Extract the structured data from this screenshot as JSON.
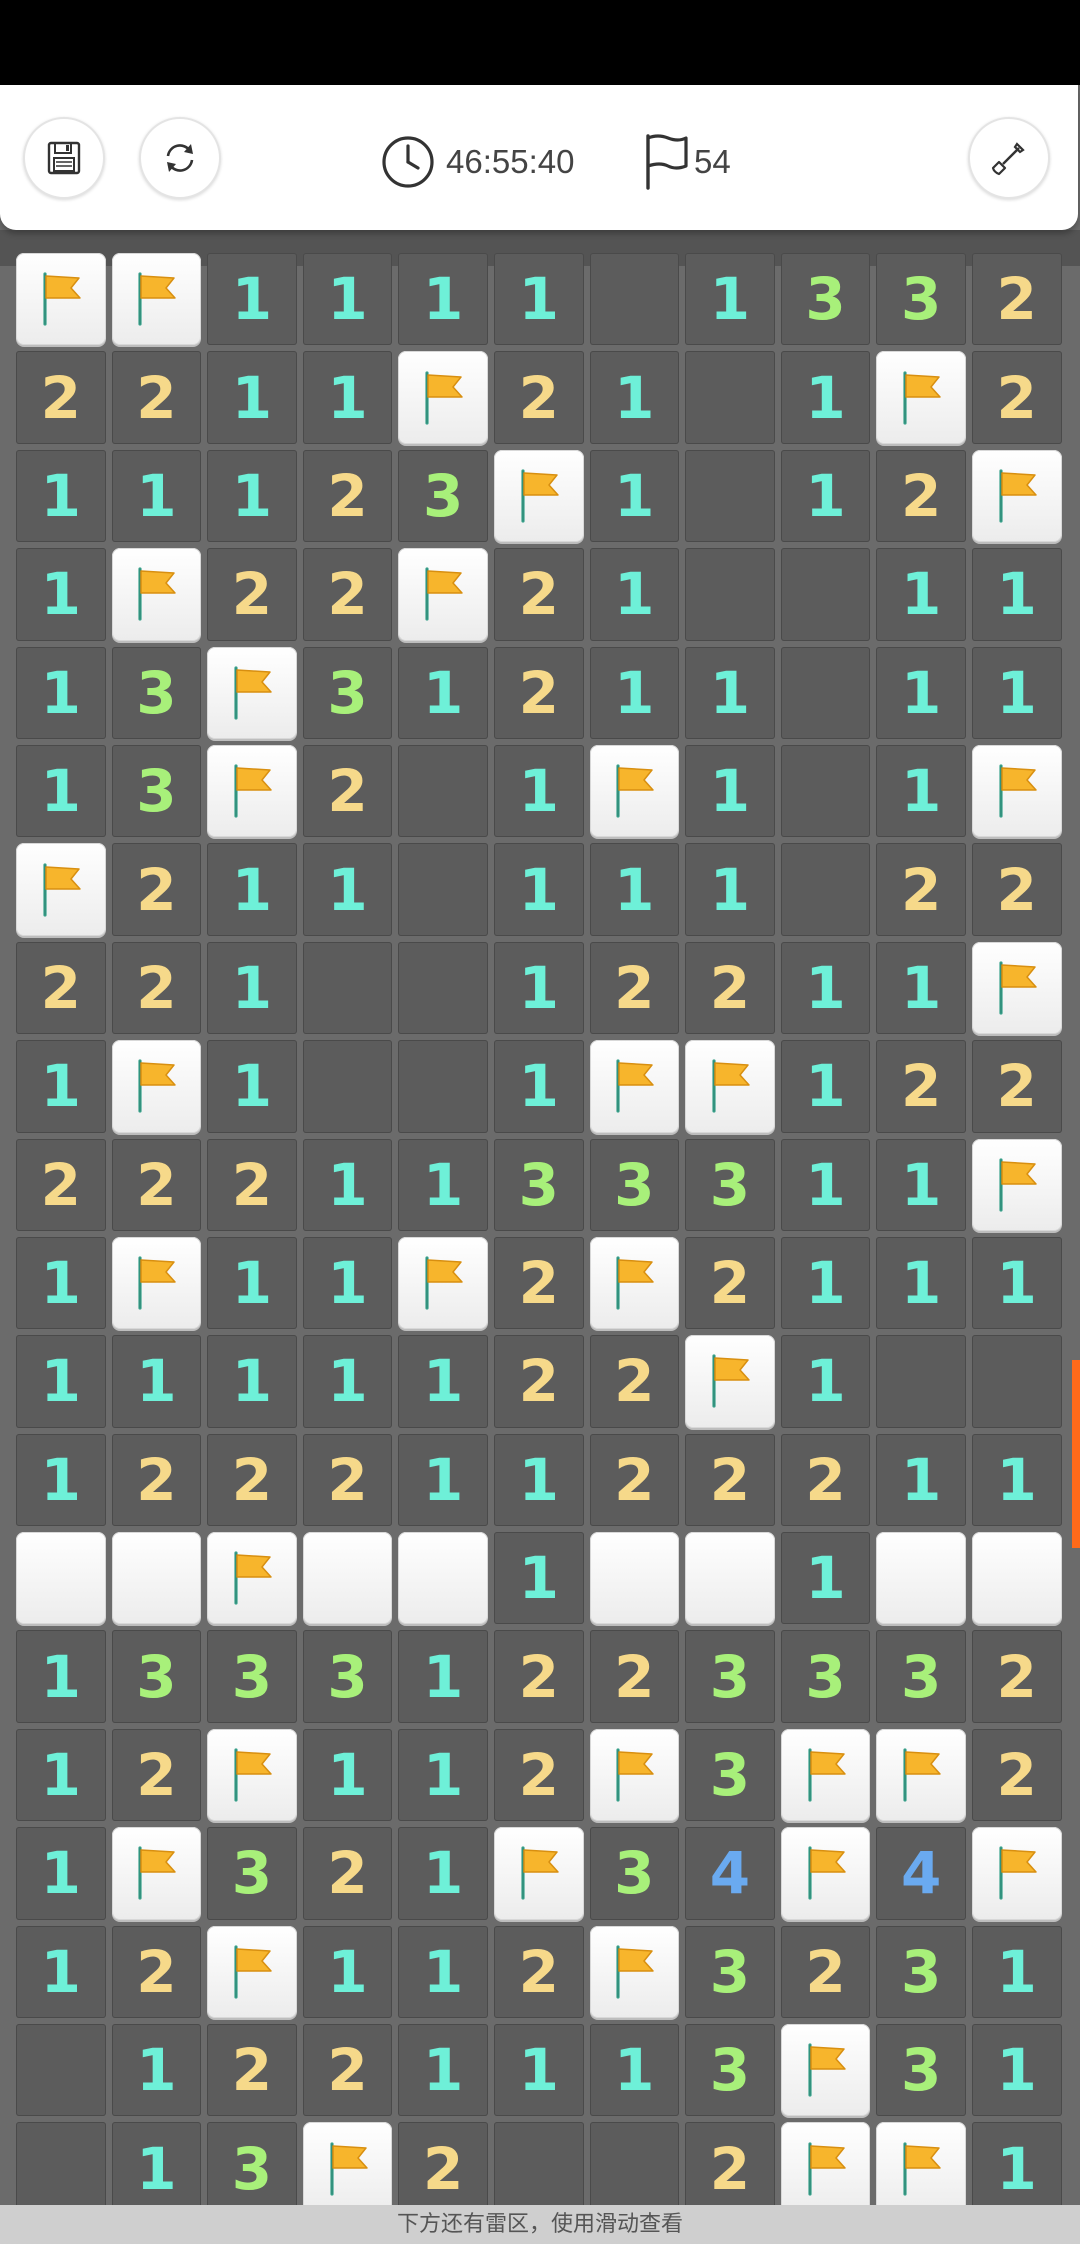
{
  "toolbar": {
    "timer": "46:55:40",
    "flags_remaining": "54"
  },
  "tip": "下方还有雷区，使用滑动查看",
  "colors": {
    "n1": "#6ef0d8",
    "n2": "#f6d98a",
    "n3": "#a8f07a",
    "n4": "#6aaaf0",
    "flag": "#f7b52c"
  },
  "grid": [
    [
      "F",
      "F",
      "1",
      "1",
      "1",
      "1",
      "0",
      "1",
      "3",
      "3",
      "2"
    ],
    [
      "2",
      "2",
      "1",
      "1",
      "F",
      "2",
      "1",
      "0",
      "1",
      "F",
      "2"
    ],
    [
      "1",
      "1",
      "1",
      "2",
      "3",
      "F",
      "1",
      "0",
      "1",
      "2",
      "F"
    ],
    [
      "1",
      "F",
      "2",
      "2",
      "F",
      "2",
      "1",
      "0",
      "0",
      "1",
      "1"
    ],
    [
      "1",
      "3",
      "F",
      "3",
      "1",
      "2",
      "1",
      "1",
      "0",
      "1",
      "1"
    ],
    [
      "1",
      "3",
      "F",
      "2",
      "0",
      "1",
      "F",
      "1",
      "0",
      "1",
      "F"
    ],
    [
      "F",
      "2",
      "1",
      "1",
      "0",
      "1",
      "1",
      "1",
      "0",
      "2",
      "2"
    ],
    [
      "2",
      "2",
      "1",
      "0",
      "0",
      "1",
      "2",
      "2",
      "1",
      "1",
      "F"
    ],
    [
      "1",
      "F",
      "1",
      "0",
      "0",
      "1",
      "F",
      "F",
      "1",
      "2",
      "2"
    ],
    [
      "2",
      "2",
      "2",
      "1",
      "1",
      "3",
      "3",
      "3",
      "1",
      "1",
      "F"
    ],
    [
      "1",
      "F",
      "1",
      "1",
      "F",
      "2",
      "F",
      "2",
      "1",
      "1",
      "1"
    ],
    [
      "1",
      "1",
      "1",
      "1",
      "1",
      "2",
      "2",
      "F",
      "1",
      "0",
      "0"
    ],
    [
      "1",
      "2",
      "2",
      "2",
      "1",
      "1",
      "2",
      "2",
      "2",
      "1",
      "1"
    ],
    [
      "U",
      "U",
      "F",
      "U",
      "U",
      "1",
      "U",
      "U",
      "1",
      "U",
      "U"
    ],
    [
      "1",
      "3",
      "3",
      "3",
      "1",
      "2",
      "2",
      "3",
      "3",
      "3",
      "2"
    ],
    [
      "1",
      "2",
      "F",
      "1",
      "1",
      "2",
      "F",
      "3",
      "F",
      "F",
      "2"
    ],
    [
      "1",
      "F",
      "3",
      "2",
      "1",
      "F",
      "3",
      "4",
      "F",
      "4",
      "F"
    ],
    [
      "1",
      "2",
      "F",
      "1",
      "1",
      "2",
      "F",
      "3",
      "2",
      "3",
      "1"
    ],
    [
      "0",
      "1",
      "2",
      "2",
      "1",
      "1",
      "1",
      "3",
      "F",
      "3",
      "1"
    ],
    [
      "0",
      "1",
      "3",
      "F",
      "2",
      "0",
      "0",
      "2",
      "F",
      "F",
      "1"
    ]
  ]
}
